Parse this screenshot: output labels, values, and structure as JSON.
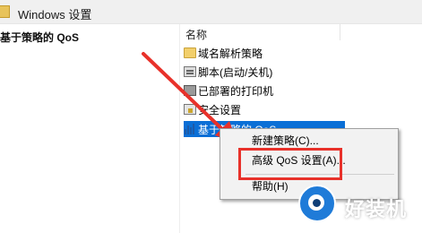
{
  "window": {
    "title": "Windows 设置"
  },
  "left_pane": {
    "header": "基于策略的 QoS"
  },
  "right_pane": {
    "column_header": "名称",
    "items": [
      {
        "label": "域名解析策略",
        "icon": "folder-icon"
      },
      {
        "label": "脚本(启动/关机)",
        "icon": "script-icon"
      },
      {
        "label": "已部署的打印机",
        "icon": "printer-icon"
      },
      {
        "label": "安全设置",
        "icon": "security-icon"
      },
      {
        "label": "基于策略的 QoS",
        "icon": "qos-chart-icon",
        "selected": true
      }
    ]
  },
  "context_menu": {
    "items": [
      {
        "label": "新建策略(C)..."
      },
      {
        "label": "高级 QoS 设置(A)..."
      },
      {
        "label": "帮助(H)"
      }
    ]
  },
  "annotation": {
    "highlight_color": "#e8312a",
    "arrow_color": "#e8312a"
  },
  "watermark": {
    "text": "好装机"
  },
  "colors": {
    "selection": "#0a6fd6",
    "menu_bg": "#f2f2f2"
  }
}
